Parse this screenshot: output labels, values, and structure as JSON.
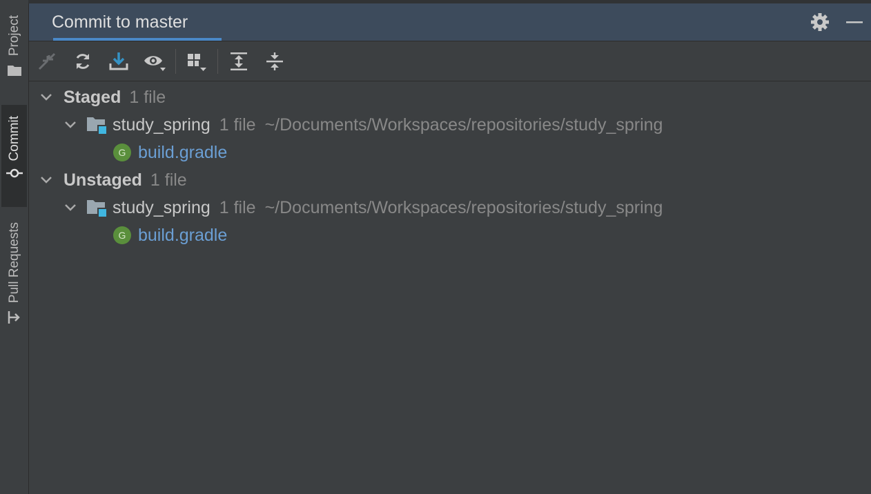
{
  "sidebar": {
    "tabs": [
      {
        "label": "Project",
        "icon": "folder-icon"
      },
      {
        "label": "Commit",
        "icon": "commit-icon"
      },
      {
        "label": "Pull Requests",
        "icon": "pull-request-icon"
      }
    ]
  },
  "header": {
    "title": "Commit to master",
    "actions": [
      "gear-icon",
      "minimize-icon"
    ]
  },
  "toolbar": {
    "buttons": [
      "rollback-icon",
      "refresh-icon",
      "update-icon",
      "view-options-icon",
      "group-by-icon",
      "expand-all-icon",
      "collapse-all-icon"
    ]
  },
  "tree": {
    "groups": [
      {
        "name": "Staged",
        "count": "1 file",
        "repo": {
          "name": "study_spring",
          "count": "1 file",
          "path": "~/Documents/Workspaces/repositories/study_spring"
        },
        "file": {
          "name": "build.gradle",
          "badge": "G"
        }
      },
      {
        "name": "Unstaged",
        "count": "1 file",
        "repo": {
          "name": "study_spring",
          "count": "1 file",
          "path": "~/Documents/Workspaces/repositories/study_spring"
        },
        "file": {
          "name": "build.gradle",
          "badge": "G"
        }
      }
    ]
  },
  "colors": {
    "background": "#3c3f41",
    "header": "#3d4b5c",
    "accent": "#4a88c7",
    "file_link": "#6b9fd4",
    "gradle_badge": "#5a8f3c"
  }
}
